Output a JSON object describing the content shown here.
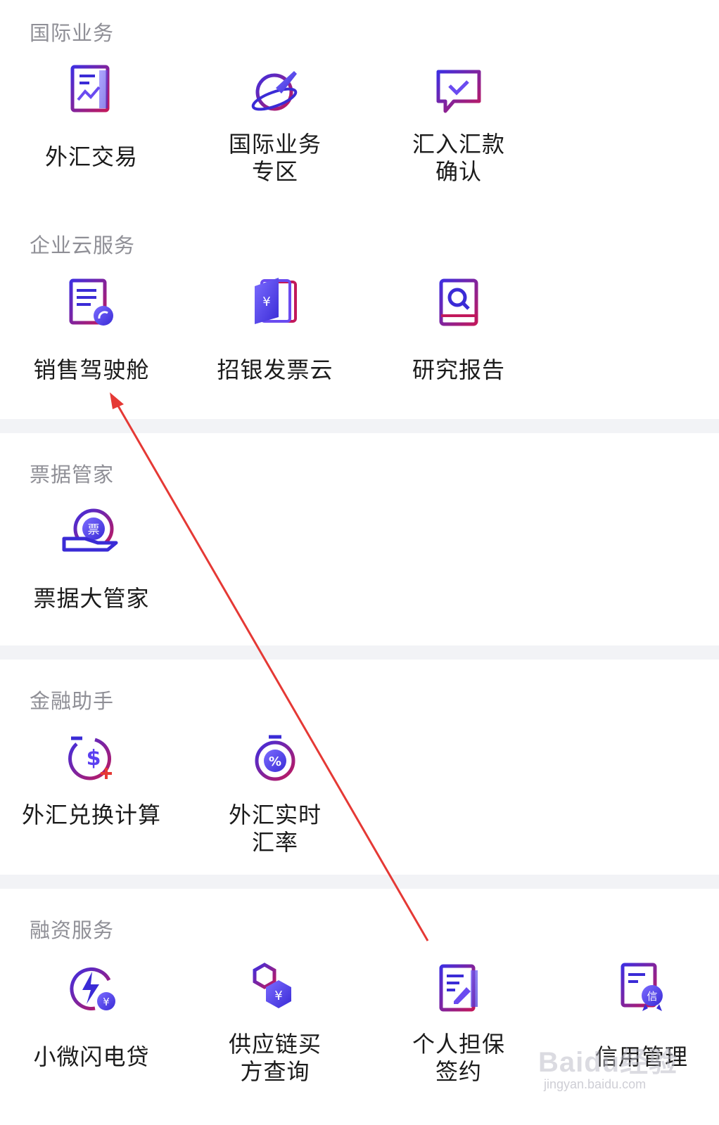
{
  "sections": [
    {
      "title": "国际业务",
      "items": [
        {
          "label": "外汇交易",
          "icon": "fx-chart-document-icon"
        },
        {
          "label": "国际业务专区",
          "icon": "globe-plane-icon"
        },
        {
          "label": "汇入汇款确认",
          "icon": "chat-check-icon"
        }
      ]
    },
    {
      "title": "企业云服务",
      "items": [
        {
          "label": "销售驾驶舱",
          "icon": "list-document-gauge-icon"
        },
        {
          "label": "招银发票云",
          "icon": "yen-invoice-book-icon"
        },
        {
          "label": "研究报告",
          "icon": "book-search-icon"
        }
      ]
    },
    {
      "title": "票据管家",
      "items": [
        {
          "label": "票据大管家",
          "icon": "hand-bill-coin-icon"
        }
      ]
    },
    {
      "title": "金融助手",
      "items": [
        {
          "label": "外汇兑换计算",
          "icon": "dollar-exchange-timer-icon"
        },
        {
          "label": "外汇实时汇率",
          "icon": "percent-stopwatch-icon"
        }
      ]
    },
    {
      "title": "融资服务",
      "items": [
        {
          "label": "小微闪电贷",
          "icon": "lightning-yen-icon"
        },
        {
          "label": "供应链买方查询",
          "icon": "hexagon-yen-icon"
        },
        {
          "label": "个人担保签约",
          "icon": "edit-document-icon"
        },
        {
          "label": "信用管理",
          "icon": "credit-badge-document-icon"
        }
      ]
    }
  ],
  "watermark": {
    "brand": "Baidu经验",
    "url": "jingyan.baidu.com"
  },
  "colors": {
    "icon_primary": "#3a2bd6",
    "icon_accent": "#c2185b",
    "arrow": "#e53935"
  }
}
